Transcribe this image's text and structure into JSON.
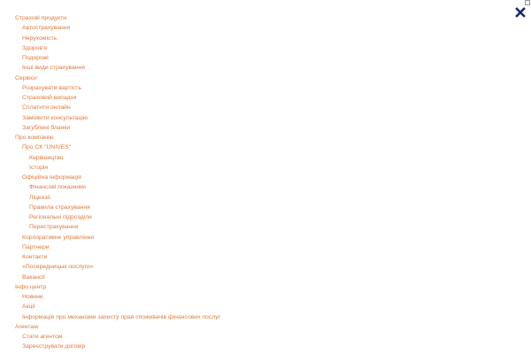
{
  "menu": {
    "items": [
      {
        "label": "Страхові продукти",
        "level": 0
      },
      {
        "label": "Автострахування",
        "level": 1
      },
      {
        "label": "Нерухомість",
        "level": 1
      },
      {
        "label": "Здоров'я",
        "level": 1
      },
      {
        "label": "Подорожі",
        "level": 1
      },
      {
        "label": "Інші види страхування",
        "level": 1
      },
      {
        "label": "Сервіси",
        "level": 0
      },
      {
        "label": "Розрахувати вартість",
        "level": 1
      },
      {
        "label": "Страховий випадок",
        "level": 1
      },
      {
        "label": "Сплатити онлайн",
        "level": 1
      },
      {
        "label": "Замовити консультацію",
        "level": 1
      },
      {
        "label": "Загублені бланки",
        "level": 1
      },
      {
        "label": "Про компанію",
        "level": 0
      },
      {
        "label": "Про СК \"UNIVES\"",
        "level": 1
      },
      {
        "label": "Керівництво",
        "level": 2
      },
      {
        "label": "Історія",
        "level": 2
      },
      {
        "label": "Офіційна інформація",
        "level": 1
      },
      {
        "label": "Фінансові показники",
        "level": 2
      },
      {
        "label": "Ліцензії",
        "level": 2
      },
      {
        "label": "Правила страхування",
        "level": 2
      },
      {
        "label": "Регіональні підрозділи",
        "level": 2
      },
      {
        "label": "Перестрахування",
        "level": 2
      },
      {
        "label": "Корпоративне управління",
        "level": 1
      },
      {
        "label": "Партнери",
        "level": 1
      },
      {
        "label": "Контакти",
        "level": 1
      },
      {
        "label": "«Посередницькі послуги»",
        "level": 1
      },
      {
        "label": "Вакансії",
        "level": 1
      },
      {
        "label": "Інфо центр",
        "level": 0
      },
      {
        "label": "Новини",
        "level": 1
      },
      {
        "label": "Акції",
        "level": 1
      },
      {
        "label": "Інформація про механізми захисту прав споживачів фінансових послуг",
        "level": 1
      },
      {
        "label": "Агентам",
        "level": 0
      },
      {
        "label": "Стати агентом",
        "level": 1
      },
      {
        "label": "Зареєструвати договір",
        "level": 1
      }
    ]
  },
  "close_icon": "close-icon",
  "colors": {
    "link": "#e07a3c",
    "close": "#1e2a6b",
    "background": "#ffffff"
  }
}
